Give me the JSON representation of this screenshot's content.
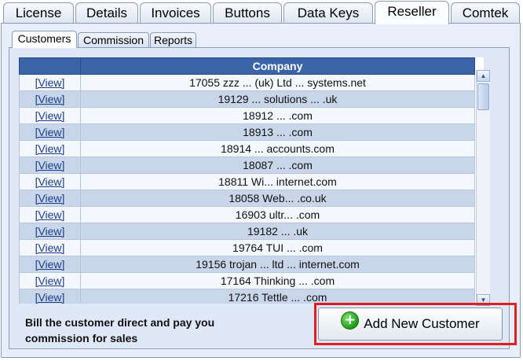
{
  "top_tabs": [
    {
      "label": "License"
    },
    {
      "label": "Details"
    },
    {
      "label": "Invoices"
    },
    {
      "label": "Buttons"
    },
    {
      "label": "Data Keys"
    },
    {
      "label": "Reseller",
      "active": true
    },
    {
      "label": "Comtek"
    }
  ],
  "sub_tabs": [
    {
      "label": "Customers",
      "active": true
    },
    {
      "label": "Commission"
    },
    {
      "label": "Reports"
    }
  ],
  "grid": {
    "header": "Company",
    "view_label": "[View]",
    "rows": [
      "17055 zzz ... (uk) Ltd ... systems.net",
      "19129 ... solutions ... .uk",
      "18912 ... .com",
      "18913 ... .com",
      "18914 ... accounts.com",
      "18087 ... .com",
      "18811 Wi... internet.com",
      "18058 Web... .co.uk",
      "16903 ultr... .com",
      "19182 ... .uk",
      "19764 TUI ... .com",
      "19156 trojan ... ltd ... internet.com",
      "17164 Thinking ... .com",
      "17216 Tettle ... .com"
    ]
  },
  "footer": {
    "line1": "Bill the customer direct and pay you",
    "line2": "commission for sales"
  },
  "add_button": {
    "label": "Add New Customer",
    "icon": "plus-circle-icon"
  },
  "colors": {
    "header_bg": "#3b64a8",
    "row_alt": "#c9d6ea",
    "highlight": "#e01e1e",
    "panel_bg": "#e8effa"
  }
}
